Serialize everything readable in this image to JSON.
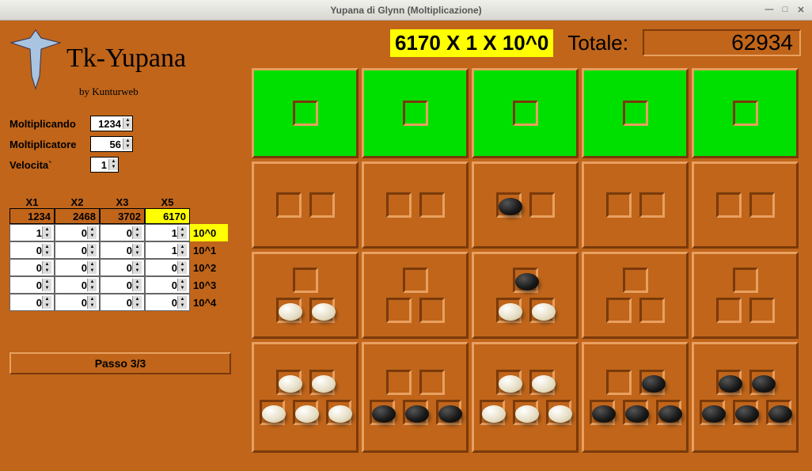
{
  "window": {
    "title": "Yupana di Glynn (Moltiplicazione)"
  },
  "app": {
    "title": "Tk-Yupana",
    "byline": "by Kunturweb"
  },
  "params": {
    "moltiplicando": {
      "label": "Moltiplicando",
      "value": "1234"
    },
    "moltiplicatore": {
      "label": "Moltiplicatore",
      "value": "56"
    },
    "velocita": {
      "label": "Velocita`",
      "value": "1"
    }
  },
  "matrix": {
    "headers": [
      "X1",
      "X2",
      "X3",
      "X5"
    ],
    "mult_row": [
      "1234",
      "2468",
      "3702",
      "6170"
    ],
    "mult_row_highlight": 3,
    "rows": [
      {
        "label": "10^0",
        "highlight": true,
        "vals": [
          "1",
          "0",
          "0",
          "1"
        ]
      },
      {
        "label": "10^1",
        "highlight": false,
        "vals": [
          "0",
          "0",
          "0",
          "1"
        ]
      },
      {
        "label": "10^2",
        "highlight": false,
        "vals": [
          "0",
          "0",
          "0",
          "0"
        ]
      },
      {
        "label": "10^3",
        "highlight": false,
        "vals": [
          "0",
          "0",
          "0",
          "0"
        ]
      },
      {
        "label": "10^4",
        "highlight": false,
        "vals": [
          "0",
          "0",
          "0",
          "0"
        ]
      }
    ]
  },
  "passo_label": "Passo 3/3",
  "top": {
    "expression": "6170 X 1 X 10^0",
    "totale_label": "Totale:",
    "totale_value": "62934"
  },
  "board": {
    "columns": [
      {
        "r1": {
          "green": true,
          "rows": [
            [
              null
            ]
          ]
        },
        "r2": {
          "rows": [
            [
              null,
              null
            ]
          ]
        },
        "r3": {
          "rows": [
            [
              null
            ],
            [
              "white",
              "white"
            ]
          ]
        },
        "r4": {
          "rows": [
            [
              "white",
              "white"
            ],
            [
              "white",
              "white",
              "white"
            ]
          ]
        }
      },
      {
        "r1": {
          "green": true,
          "rows": [
            [
              null
            ]
          ]
        },
        "r2": {
          "rows": [
            [
              null,
              null
            ]
          ]
        },
        "r3": {
          "rows": [
            [
              null
            ],
            [
              null,
              null
            ]
          ]
        },
        "r4": {
          "rows": [
            [
              null,
              null
            ],
            [
              "black",
              "black",
              "black"
            ]
          ]
        }
      },
      {
        "r1": {
          "green": true,
          "rows": [
            [
              null
            ]
          ]
        },
        "r2": {
          "rows": [
            [
              "black",
              null
            ]
          ]
        },
        "r3": {
          "rows": [
            [
              "black"
            ],
            [
              "white",
              "white"
            ]
          ]
        },
        "r4": {
          "rows": [
            [
              "white",
              "white"
            ],
            [
              "white",
              "white",
              "white"
            ]
          ]
        }
      },
      {
        "r1": {
          "green": true,
          "rows": [
            [
              null
            ]
          ]
        },
        "r2": {
          "rows": [
            [
              null,
              null
            ]
          ]
        },
        "r3": {
          "rows": [
            [
              null
            ],
            [
              null,
              null
            ]
          ]
        },
        "r4": {
          "rows": [
            [
              null,
              "black"
            ],
            [
              "black",
              "black",
              "black"
            ]
          ]
        }
      },
      {
        "r1": {
          "green": true,
          "rows": [
            [
              null
            ]
          ]
        },
        "r2": {
          "rows": [
            [
              null,
              null
            ]
          ]
        },
        "r3": {
          "rows": [
            [
              null
            ],
            [
              null,
              null
            ]
          ]
        },
        "r4": {
          "rows": [
            [
              "black",
              "black"
            ],
            [
              "black",
              "black",
              "black"
            ]
          ]
        }
      }
    ]
  }
}
